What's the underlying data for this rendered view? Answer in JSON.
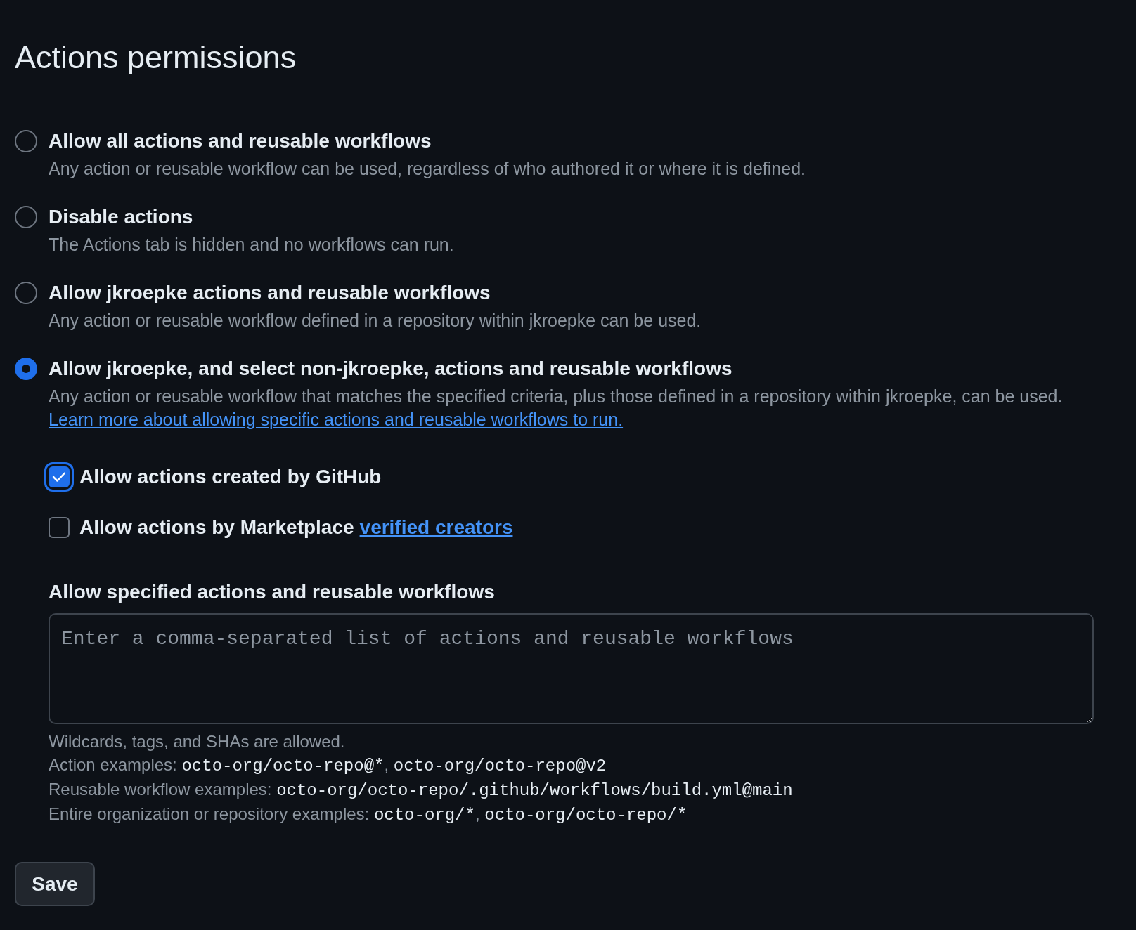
{
  "title": "Actions permissions",
  "options": [
    {
      "label": "Allow all actions and reusable workflows",
      "description": "Any action or reusable workflow can be used, regardless of who authored it or where it is defined.",
      "selected": false
    },
    {
      "label": "Disable actions",
      "description": "The Actions tab is hidden and no workflows can run.",
      "selected": false
    },
    {
      "label": "Allow jkroepke actions and reusable workflows",
      "description": "Any action or reusable workflow defined in a repository within jkroepke can be used.",
      "selected": false
    },
    {
      "label": "Allow jkroepke, and select non-jkroepke, actions and reusable workflows",
      "description": "Any action or reusable workflow that matches the specified criteria, plus those defined in a repository within jkroepke, can be used.",
      "link": "Learn more about allowing specific actions and reusable workflows to run.",
      "selected": true
    }
  ],
  "checkboxes": [
    {
      "label": "Allow actions created by GitHub",
      "checked": true,
      "focused": true
    },
    {
      "label": "Allow actions by Marketplace",
      "link": "verified creators",
      "checked": false,
      "focused": false
    }
  ],
  "allowlist": {
    "label": "Allow specified actions and reusable workflows",
    "placeholder": "Enter a comma-separated list of actions and reusable workflows"
  },
  "help_lines": [
    [
      {
        "kind": "text",
        "text": "Wildcards, tags, and SHAs are allowed."
      }
    ],
    [
      {
        "kind": "text",
        "text": "Action examples: "
      },
      {
        "kind": "code",
        "text": "octo-org/octo-repo@*"
      },
      {
        "kind": "text",
        "text": ", "
      },
      {
        "kind": "code",
        "text": "octo-org/octo-repo@v2"
      }
    ],
    [
      {
        "kind": "text",
        "text": "Reusable workflow examples: "
      },
      {
        "kind": "code",
        "text": "octo-org/octo-repo/.github/workflows/build.yml@main"
      }
    ],
    [
      {
        "kind": "text",
        "text": "Entire organization or repository examples: "
      },
      {
        "kind": "code",
        "text": "octo-org/*"
      },
      {
        "kind": "text",
        "text": ", "
      },
      {
        "kind": "code",
        "text": "octo-org/octo-repo/*"
      }
    ]
  ],
  "save_button": "Save"
}
